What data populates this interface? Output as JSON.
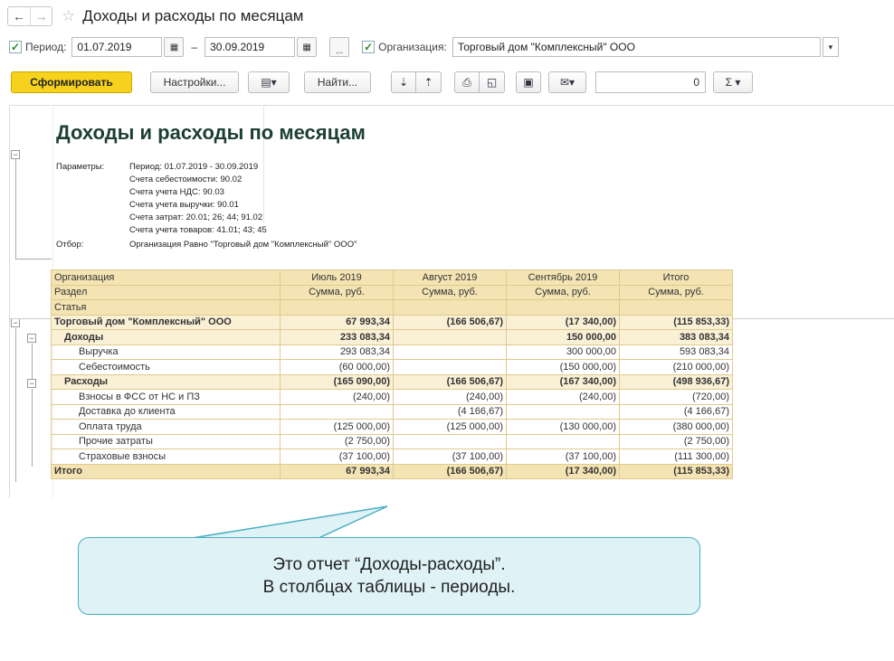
{
  "window": {
    "title": "Доходы и расходы по месяцам",
    "back_icon": "←",
    "forward_icon": "→",
    "star_icon": "☆"
  },
  "params_bar": {
    "period_label": "Период:",
    "date_from": "01.07.2019",
    "date_to": "30.09.2019",
    "dash": "–",
    "dots": "...",
    "org_label": "Организация:",
    "org_value": "Торговый дом \"Комплексный\" ООО"
  },
  "toolbar": {
    "generate": "Сформировать",
    "settings": "Настройки...",
    "find": "Найти...",
    "sum_value": "0",
    "sigma": "Σ"
  },
  "report": {
    "title": "Доходы и расходы по месяцам",
    "params_key": "Параметры:",
    "params": [
      "Период: 01.07.2019 - 30.09.2019",
      "Счета себестоимости: 90.02",
      "Счета учета НДС: 90.03",
      "Счета учета выручки: 90.01",
      "Счета затрат: 20.01; 26; 44; 91.02",
      "Счета учета товаров: 41.01; 43; 45"
    ],
    "filter_key": "Отбор:",
    "filter_value": "Организация Равно \"Торговый дом \"Комплексный\" ООО\"",
    "headers": {
      "col1": [
        "Организация",
        "Раздел",
        "Статья"
      ],
      "months": [
        "Июль 2019",
        "Август 2019",
        "Сентябрь 2019",
        "Итого"
      ],
      "sum": "Сумма, руб."
    },
    "rows": [
      {
        "name": "Торговый дом \"Комплексный\" ООО",
        "v": [
          "67 993,34",
          "(166 506,67)",
          "(17 340,00)",
          "(115 853,33)"
        ]
      },
      {
        "name": "Доходы",
        "v": [
          "233 083,34",
          "",
          "150 000,00",
          "383 083,34"
        ]
      },
      {
        "name": "Выручка",
        "v": [
          "293 083,34",
          "",
          "300 000,00",
          "593 083,34"
        ]
      },
      {
        "name": "Себестоимость",
        "v": [
          "(60 000,00)",
          "",
          "(150 000,00)",
          "(210 000,00)"
        ]
      },
      {
        "name": "Расходы",
        "v": [
          "(165 090,00)",
          "(166 506,67)",
          "(167 340,00)",
          "(498 936,67)"
        ]
      },
      {
        "name": "Взносы в ФСС от НС и ПЗ",
        "v": [
          "(240,00)",
          "(240,00)",
          "(240,00)",
          "(720,00)"
        ]
      },
      {
        "name": "Доставка до клиента",
        "v": [
          "",
          "(4 166,67)",
          "",
          "(4 166,67)"
        ]
      },
      {
        "name": "Оплата труда",
        "v": [
          "(125 000,00)",
          "(125 000,00)",
          "(130 000,00)",
          "(380 000,00)"
        ]
      },
      {
        "name": "Прочие затраты",
        "v": [
          "(2 750,00)",
          "",
          "",
          "(2 750,00)"
        ]
      },
      {
        "name": "Страховые взносы",
        "v": [
          "(37 100,00)",
          "(37 100,00)",
          "(37 100,00)",
          "(111 300,00)"
        ]
      },
      {
        "name": "Итого",
        "v": [
          "67 993,34",
          "(166 506,67)",
          "(17 340,00)",
          "(115 853,33)"
        ]
      }
    ]
  },
  "callout": {
    "line1": "Это отчет “Доходы-расходы”.",
    "line2": "В столбцах таблицы - периоды."
  }
}
